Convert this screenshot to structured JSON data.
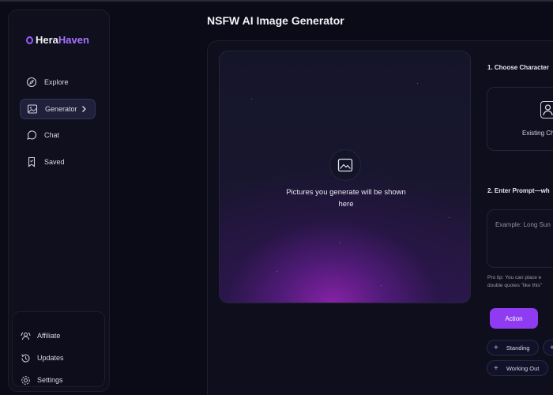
{
  "app": {
    "brand_part1": "Hera",
    "brand_part2": "Haven",
    "page_title": "NSFW AI Image Generator"
  },
  "sidebar": {
    "items": [
      {
        "label": "Explore",
        "icon": "compass-icon"
      },
      {
        "label": "Generator",
        "icon": "image-icon",
        "active": true
      },
      {
        "label": "Chat",
        "icon": "chat-icon"
      },
      {
        "label": "Saved",
        "icon": "bookmark-icon"
      }
    ],
    "bottom_items": [
      {
        "label": "Affiliate",
        "icon": "affiliate-icon"
      },
      {
        "label": "Updates",
        "icon": "history-icon"
      },
      {
        "label": "Settings",
        "icon": "gear-icon"
      }
    ]
  },
  "canvas": {
    "placeholder": "Pictures you generate will be shown here"
  },
  "form": {
    "step1_label": "1. Choose Character",
    "character_option": "Existing Ch",
    "step2_label": "2. Enter Prompt—wh",
    "prompt_placeholder": "Example: Long Sun",
    "pro_tip_line1": "Pro tip: You can place e",
    "pro_tip_line2": "double quotes \"like this\"",
    "action_label": "Action",
    "chips": [
      "Standing",
      "",
      "Working Out"
    ]
  },
  "colors": {
    "accent": "#8e3bf2",
    "background": "#0b0b18",
    "panel": "#0e0e1d"
  }
}
